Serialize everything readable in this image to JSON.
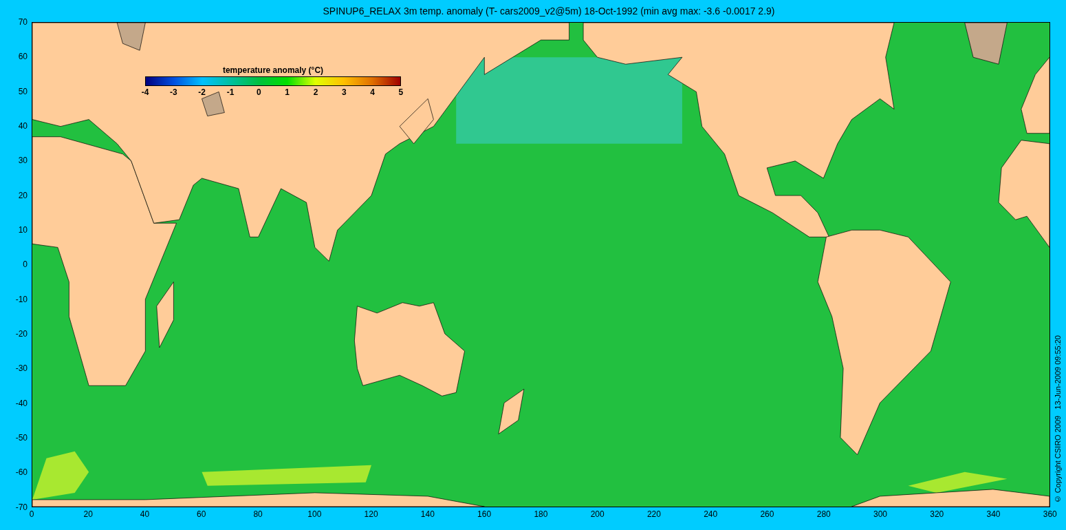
{
  "title": "SPINUP6_RELAX 3m temp. anomaly (T- cars2009_v2@5m) 18-Oct-1992 (min avg max: -3.6 -0.0017 2.9)",
  "colorbar": {
    "label": "temperature anomaly (°C)",
    "ticks": [
      "-4",
      "-3",
      "-2",
      "-1",
      "0",
      "1",
      "2",
      "3",
      "4",
      "5"
    ]
  },
  "y_axis": {
    "labels": [
      "70",
      "60",
      "50",
      "40",
      "30",
      "20",
      "10",
      "0",
      "-10",
      "-20",
      "-30",
      "-40",
      "-50",
      "-60",
      "-70"
    ]
  },
  "x_axis": {
    "labels": [
      "0",
      "20",
      "40",
      "60",
      "80",
      "100",
      "120",
      "140",
      "160",
      "180",
      "200",
      "220",
      "240",
      "260",
      "280",
      "300",
      "320",
      "340",
      "360"
    ]
  },
  "copyright": "© Copyright CSIRO 2009   13-Jun-2009 09:55:20"
}
